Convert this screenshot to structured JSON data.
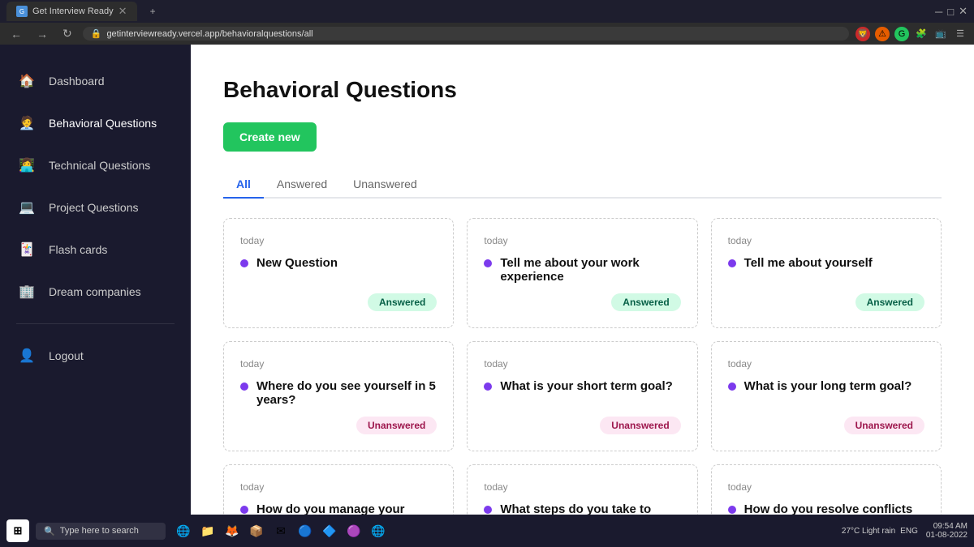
{
  "browser": {
    "tab_title": "Get Interview Ready",
    "url": "getinterviewready.vercel.app/behavioralquestions/all",
    "new_tab_icon": "+"
  },
  "sidebar": {
    "items": [
      {
        "id": "dashboard",
        "label": "Dashboard",
        "icon": "🏠",
        "active": false
      },
      {
        "id": "behavioral",
        "label": "Behavioral Questions",
        "icon": "🧑‍💼",
        "active": true
      },
      {
        "id": "technical",
        "label": "Technical Questions",
        "icon": "👩‍💻",
        "active": false
      },
      {
        "id": "project",
        "label": "Project Questions",
        "icon": "💻",
        "active": false
      },
      {
        "id": "flashcards",
        "label": "Flash cards",
        "icon": "🃏",
        "active": false
      },
      {
        "id": "dream",
        "label": "Dream companies",
        "icon": "🏢",
        "active": false
      }
    ],
    "logout_label": "Logout"
  },
  "main": {
    "page_title": "Behavioral Questions",
    "create_button": "Create new",
    "tabs": [
      {
        "id": "all",
        "label": "All",
        "active": true
      },
      {
        "id": "answered",
        "label": "Answered",
        "active": false
      },
      {
        "id": "unanswered",
        "label": "Unanswered",
        "active": false
      }
    ],
    "cards": [
      {
        "date": "today",
        "question": "New Question",
        "badge": "Answered",
        "badge_type": "answered"
      },
      {
        "date": "today",
        "question": "Tell me about your work experience",
        "badge": "Answered",
        "badge_type": "answered"
      },
      {
        "date": "today",
        "question": "Tell me about yourself",
        "badge": "Answered",
        "badge_type": "answered"
      },
      {
        "date": "today",
        "question": "Where do you see yourself in 5 years?",
        "badge": "Unanswered",
        "badge_type": "unanswered"
      },
      {
        "date": "today",
        "question": "What is your short term goal?",
        "badge": "Unanswered",
        "badge_type": "unanswered"
      },
      {
        "date": "today",
        "question": "What is your long term goal?",
        "badge": "Unanswered",
        "badge_type": "unanswered"
      },
      {
        "date": "today",
        "question": "How do you manage your",
        "badge": "",
        "badge_type": ""
      },
      {
        "date": "today",
        "question": "What steps do you take to",
        "badge": "",
        "badge_type": ""
      },
      {
        "date": "today",
        "question": "How do you resolve conflicts",
        "badge": "",
        "badge_type": ""
      }
    ]
  },
  "taskbar": {
    "search_placeholder": "Type here to search",
    "weather": "27°C Light rain",
    "language": "ENG",
    "time": "09:54 AM",
    "date": "01-08-2022"
  }
}
